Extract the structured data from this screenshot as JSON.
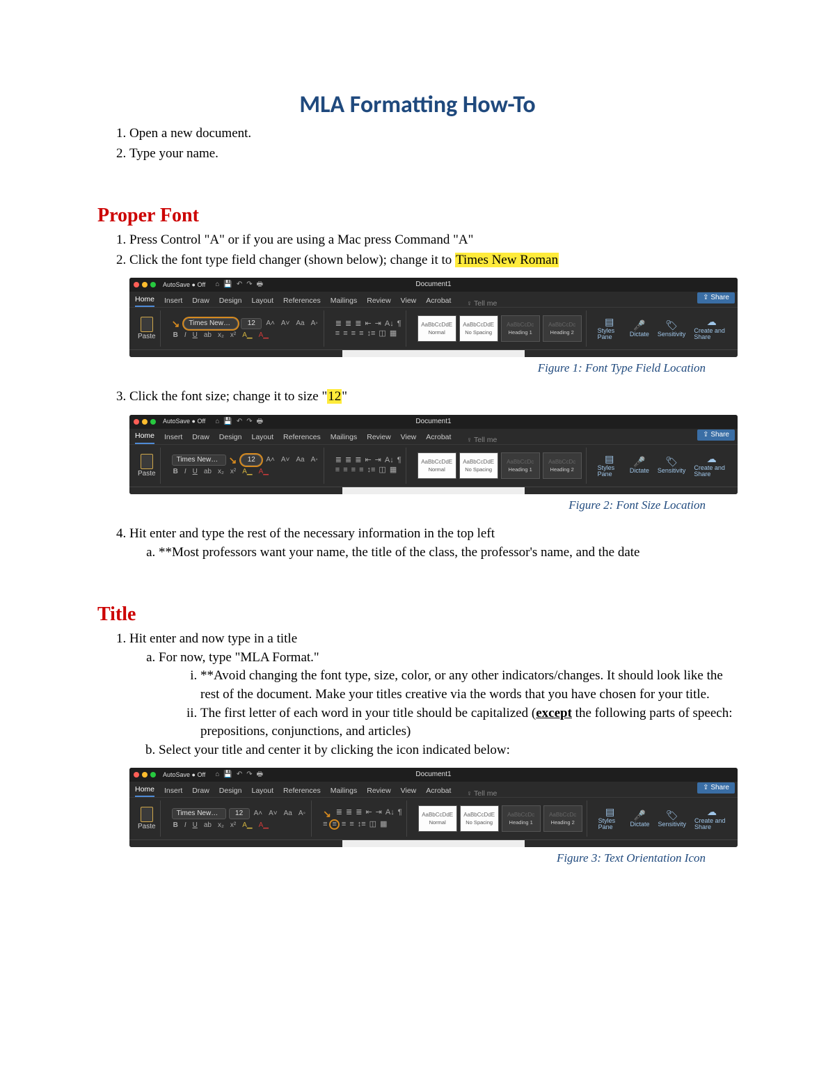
{
  "title": "MLA Formatting How-To",
  "intro_steps": [
    "Open a new document.",
    "Type your name."
  ],
  "sections": {
    "properFont": {
      "heading": "Proper Font",
      "step1": "Press Control \"A\" or if you are using a Mac press Command \"A\"",
      "step2_pre": "Click the font type field changer (shown below); change it to ",
      "step2_hl": "Times New Roman",
      "step3_pre": "Click the font size; change it to size \"",
      "step3_hl": "12",
      "step3_post": "\"",
      "step4": "Hit enter and type the rest of the necessary information in the top left",
      "step4a": "**Most professors want your name, the title of the class, the professor's name, and the date"
    },
    "titleSec": {
      "heading": "Title",
      "step1": "Hit enter and now type in a title",
      "step1a": "For now, type \"MLA Format.\"",
      "step1a_i": "**Avoid changing the font type, size, color, or any other indicators/changes.  It should look like the rest of the document.  Make your titles creative via the words that you have chosen for your title.",
      "step1a_ii_pre": "The first letter of each word in your title should be capitalized (",
      "step1a_ii_bold": "except",
      "step1a_ii_post": " the following parts of speech:  prepositions, conjunctions, and articles)",
      "step1b": "Select your title and center it by clicking the icon indicated below:"
    }
  },
  "figures": {
    "f1": "Figure 1:  Font Type Field Location",
    "f2": "Figure 2:  Font Size Location",
    "f3": "Figure 3:  Text Orientation Icon"
  },
  "ribbon": {
    "docTitle": "Document1",
    "autosave": "AutoSave ● Off",
    "tabs": [
      "Home",
      "Insert",
      "Draw",
      "Design",
      "Layout",
      "References",
      "Mailings",
      "Review",
      "View",
      "Acrobat"
    ],
    "tellMe": "Tell me",
    "share": "Share",
    "paste": "Paste",
    "fontName": "Times New…",
    "fontSize": "12",
    "styleBoxes": [
      {
        "preview": "AaBbCcDdE",
        "label": "Normal"
      },
      {
        "preview": "AaBbCcDdE",
        "label": "No Spacing"
      },
      {
        "preview": "AaBbCcDc",
        "label": "Heading 1"
      },
      {
        "preview": "AaBbCcDc",
        "label": "Heading 2"
      }
    ],
    "end": {
      "pane": "Styles Pane",
      "dictate": "Dictate",
      "sensitivity": "Sensitivity",
      "create": "Create and Share"
    }
  }
}
